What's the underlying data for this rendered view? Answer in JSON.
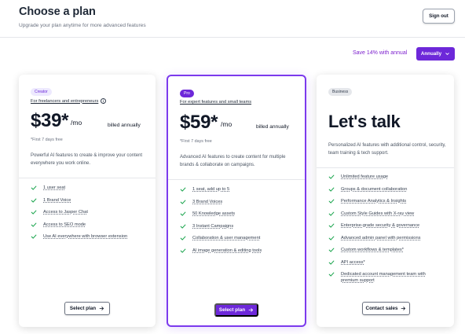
{
  "header": {
    "title": "Choose a plan",
    "subtitle": "Upgrade your plan anytime for more advanced features",
    "signout_label": "Sign out"
  },
  "billing": {
    "save_text": "Save 14% with annual",
    "selected": "Annually",
    "accent": "#6d28d9"
  },
  "plans": [
    {
      "badge": "Creator",
      "target": "For freelancers and entrepreneurs",
      "price": "$39*",
      "per": "/mo",
      "billed": "billed annually",
      "trial": "*First 7 days free",
      "description": "Powerful AI features to create & improve your content everywhere you work online.",
      "features": [
        "1 user seat",
        "1 Brand Voice",
        "Access to Jasper Chat",
        "Access to SEO mode",
        "Use AI everywhere with browser extension"
      ],
      "button": "Select plan"
    },
    {
      "badge": "Pro",
      "target": "For expert features and small teams",
      "price": "$59*",
      "per": "/mo",
      "billed": "billed annually",
      "trial": "*First 7 days free",
      "description": "Advanced AI features to create content for multiple brands & collaborate on campaigns.",
      "features": [
        "1 seat, add up to 5",
        "3 Brand Voices",
        "50 Knowledge assets",
        "3 Instant Campaigns",
        "Collaboration & user management",
        "AI image generation & editing tools"
      ],
      "button": "Select plan"
    },
    {
      "badge": "Business",
      "headline": "Let's talk",
      "description": "Personalized AI features with additional control, security, team training & tech support.",
      "features": [
        "Unlimited feature usage",
        "Groups & document collaboration",
        "Performance Analytics & Insights",
        "Custom Style Guides with X-ray view",
        "Enterprise-grade security & governance",
        "Advanced admin panel with permissions",
        "Custom workflows & templates*",
        "API access*",
        "Dedicated account management team with premium support"
      ],
      "button": "Contact sales"
    }
  ]
}
